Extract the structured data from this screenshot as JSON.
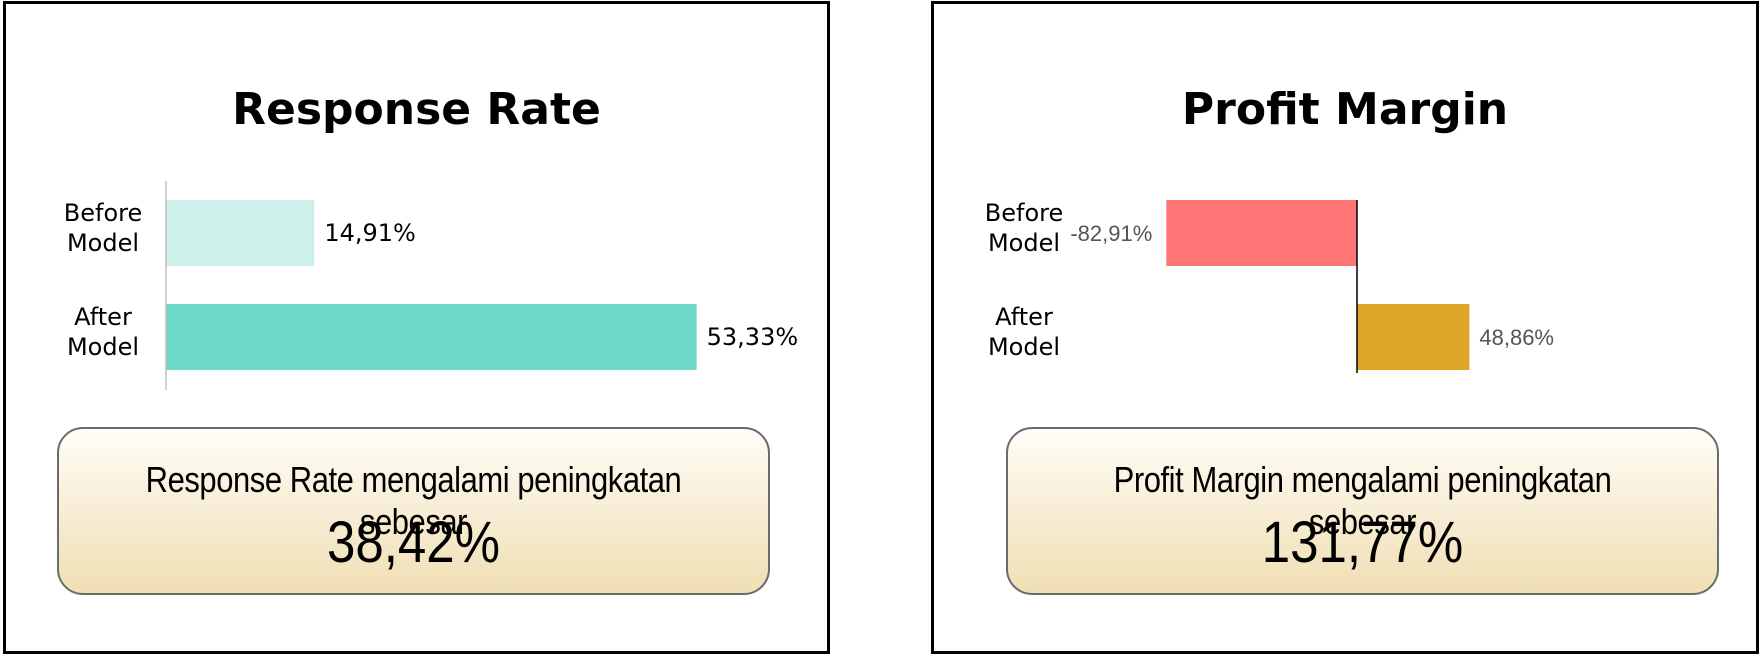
{
  "panels": [
    {
      "title": "Response Rate",
      "summary_text": "Response Rate mengalami peningkatan sebesar",
      "summary_value": "38,42%"
    },
    {
      "title": "Profit Margin",
      "summary_text": "Profit Margin mengalami peningkatan sebesar",
      "summary_value": "131,77%"
    }
  ],
  "chart_data": [
    {
      "type": "bar",
      "orientation": "horizontal",
      "title": "Response Rate",
      "categories": [
        [
          "Before",
          "Model"
        ],
        [
          "After",
          "Model"
        ]
      ],
      "values": [
        14.91,
        53.33
      ],
      "value_labels": [
        "14,91%",
        "53,33%"
      ],
      "colors": [
        "#cdf0eb",
        "#6dd9c8"
      ],
      "xlim": [
        0,
        60
      ]
    },
    {
      "type": "bar",
      "orientation": "horizontal",
      "title": "Profit Margin",
      "categories": [
        [
          "Before",
          "Model"
        ],
        [
          "After",
          "Model"
        ]
      ],
      "values": [
        -82.91,
        48.86
      ],
      "value_labels": [
        "-82,91%",
        "48,86%"
      ],
      "colors": [
        "#ff7575",
        "#dea626"
      ],
      "xlim": [
        -90,
        60
      ]
    }
  ]
}
